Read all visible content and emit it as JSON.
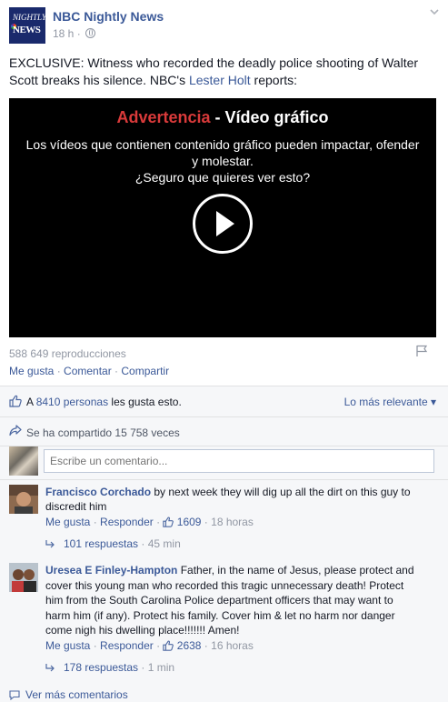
{
  "post": {
    "page_name": "NBC Nightly News",
    "logo_line1": "NIGHTLY",
    "logo_line2": "NEWS",
    "time": "18 h",
    "separator": "·",
    "text_before": "EXCLUSIVE: Witness who recorded the deadly police shooting of Walter Scott breaks his silence. NBC's ",
    "text_link": "Lester Holt",
    "text_after": " reports:"
  },
  "video": {
    "warning_red": "Advertencia",
    "warning_rest": " - Vídeo gráfico",
    "warning_line1": "Los vídeos que contienen contenido gráfico pueden impactar, ofender",
    "warning_line2": "y molestar.",
    "warning_question": "¿Seguro que quieres ver esto?",
    "views": "588 649 reproducciones"
  },
  "actions": {
    "like": "Me gusta",
    "comment": "Comentar",
    "share": "Compartir",
    "dot": " · "
  },
  "feedback": {
    "likes_prefix": "A ",
    "likes_link": "8410 personas",
    "likes_suffix": " les gusta esto.",
    "sort_label": "Lo más relevante ▾",
    "shared": "Se ha compartido 15 758 veces",
    "write_placeholder": "Escribe un comentario..."
  },
  "comments": [
    {
      "author": "Francisco Corchado",
      "text": " by next week they will dig up all the dirt on this guy to discredit him",
      "like": "Me gusta",
      "reply": "Responder",
      "likes": "1609",
      "time": "18 horas",
      "replies": "101 respuestas",
      "replies_time": "45 min"
    },
    {
      "author": "Uresea E Finley-Hampton",
      "text": " Father, in the name of Jesus, please protect and cover this young man who recorded this tragic unnecessary death! Protect him from the South Carolina Police department officers that may want to harm him (if any). Protect his family. Cover him & let no harm nor danger come nigh his dwelling place!!!!!!! Amen!",
      "like": "Me gusta",
      "reply": "Responder",
      "likes": "2638",
      "time": "16 horas",
      "replies": "178 respuestas",
      "replies_time": "1 min"
    }
  ],
  "more_comments": "Ver más comentarios",
  "colors": {
    "link": "#3b5998",
    "muted": "#9197a3",
    "warning_red": "#d93a3a",
    "feedback_bg": "#f6f7f9"
  }
}
